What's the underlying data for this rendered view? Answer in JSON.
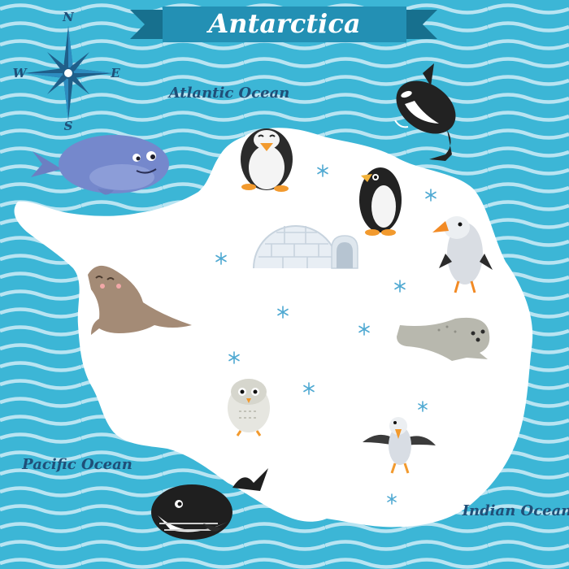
{
  "map": {
    "title": "Antarctica",
    "oceans": {
      "atlantic": "Atlantic Ocean",
      "pacific": "Pacific Ocean",
      "indian": "Indian Ocean"
    },
    "compass": {
      "north": "N",
      "south": "S",
      "east": "E",
      "west": "W"
    }
  },
  "colors": {
    "sea": "#3cb6d6",
    "wave": "#b8e4f2",
    "land": "#ffffff",
    "ribbon": "#2390b4",
    "ribbon_dark": "#17708e",
    "text_dark": "#1f4f78",
    "snow": "#4fa9d2"
  },
  "icons": [
    "compass-rose-icon",
    "whale-icon",
    "orca-icon",
    "penguin-icon",
    "igloo-icon",
    "albatross-icon",
    "seal-icon",
    "owl-icon",
    "seagull-icon",
    "snowflake-icon"
  ]
}
